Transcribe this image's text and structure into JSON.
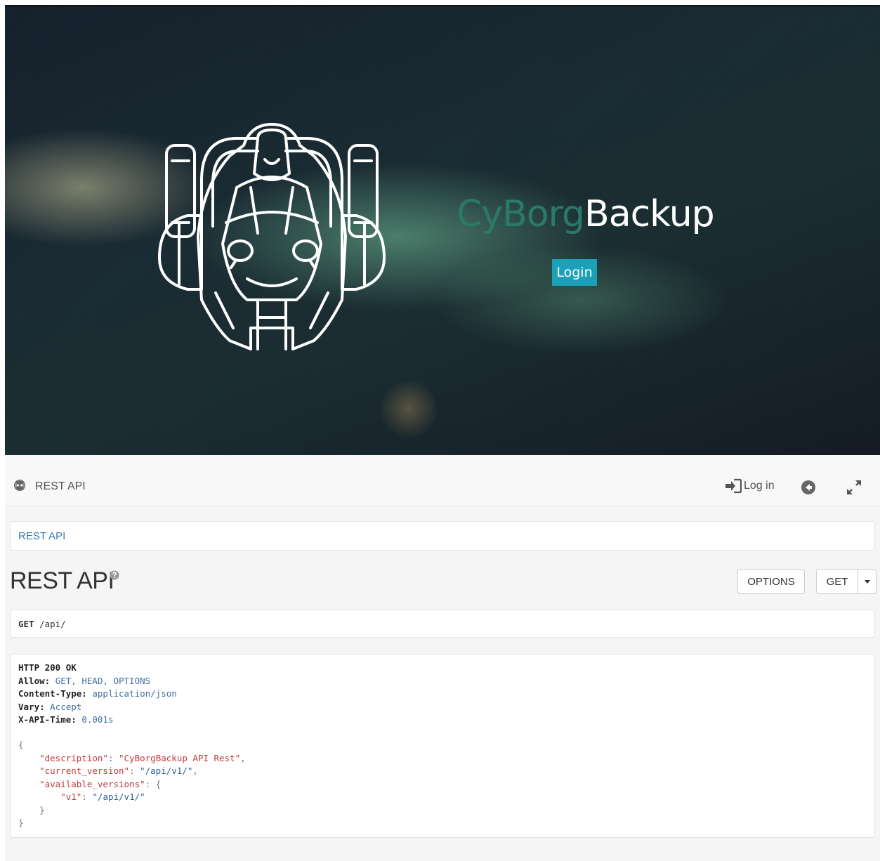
{
  "hero": {
    "brand_part1": "CyBorg",
    "brand_part2": "Backup",
    "login_label": "Login"
  },
  "navbar": {
    "title": "REST API",
    "login_label": "Log in",
    "icons": [
      "cyborg-logo-icon",
      "sign-in-icon",
      "back-icon",
      "expand-icon"
    ]
  },
  "breadcrumb": {
    "item": "REST API"
  },
  "page": {
    "title": "REST API",
    "options_label": "OPTIONS",
    "get_label": "GET"
  },
  "request": {
    "method": "GET",
    "path": "/api/"
  },
  "response": {
    "status": "HTTP 200 OK",
    "headers": [
      {
        "name": "Allow:",
        "value": "GET, HEAD, OPTIONS"
      },
      {
        "name": "Content-Type:",
        "value": "application/json"
      },
      {
        "name": "Vary:",
        "value": "Accept"
      },
      {
        "name": "X-API-Time:",
        "value": "0.001s"
      }
    ],
    "body": {
      "open": "{",
      "close": "}",
      "description_key": "\"description\"",
      "description_value": "\"CyBorgBackup API Rest\"",
      "current_version_key": "\"current_version\"",
      "current_version_value": "\"/api/v1/\"",
      "available_versions_key": "\"available_versions\"",
      "v1_key": "\"v1\"",
      "v1_value": "\"/api/v1/\""
    }
  },
  "colors": {
    "login_button": "#1ba0b8",
    "brand_cy": "#2a7a68",
    "link": "#337ab7",
    "json_string": "#c23a3a"
  }
}
